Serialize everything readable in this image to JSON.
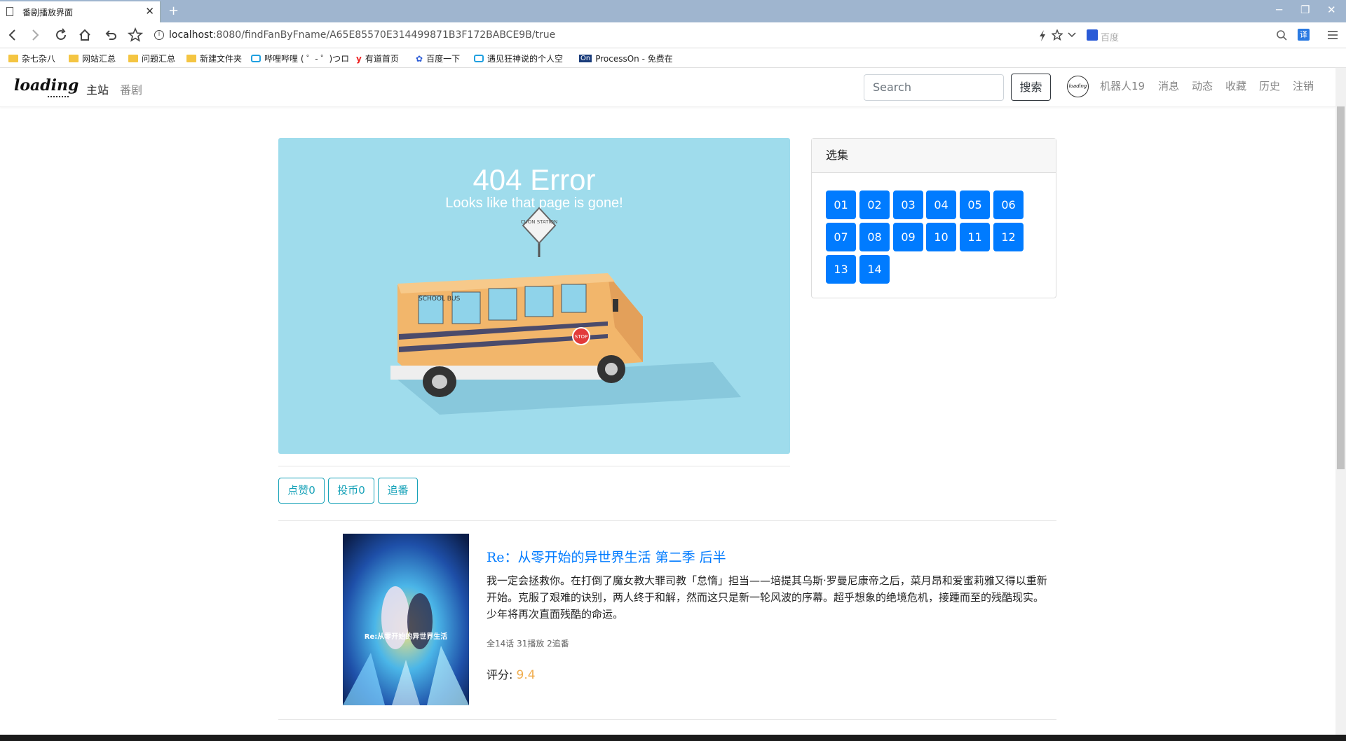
{
  "browser": {
    "tab_title": "番剧播放界面",
    "tab_close": "✕",
    "new_tab": "+",
    "url_host": "localhost",
    "url_rest": ":8080/findFanByFname/A65E85570E314499871B3F172BABCE9B/true",
    "search_engine_placeholder": "百度",
    "window_controls": [
      "─",
      "❐",
      "✕"
    ]
  },
  "bookmarks": [
    {
      "label": "杂七杂八",
      "icon": "folder-icon"
    },
    {
      "label": "网站汇总",
      "icon": "folder-icon"
    },
    {
      "label": "问题汇总",
      "icon": "folder-icon"
    },
    {
      "label": "新建文件夹",
      "icon": "folder-icon"
    },
    {
      "label": "哔哩哔哩 ( ゜- ゜)つロ",
      "icon": "bilibili-icon"
    },
    {
      "label": "有道首页",
      "icon": "youdao-icon"
    },
    {
      "label": "百度一下",
      "icon": "baidu-paw-icon"
    },
    {
      "label": "遇见狂神说的个人空",
      "icon": "bilibili-icon"
    },
    {
      "label": "ProcessOn - 免费在",
      "icon": "processon-icon"
    }
  ],
  "navbar": {
    "logo": "loading",
    "links": [
      "主站",
      "番剧"
    ],
    "search_placeholder": "Search",
    "search_button": "搜索",
    "avatar_text": "loading",
    "username": "机器人19",
    "right_links": [
      "消息",
      "动态",
      "收藏",
      "历史",
      "注销"
    ]
  },
  "player": {
    "error_title": "404 Error",
    "error_subtitle": "Looks like that page is gone!",
    "bus_sign": "SCHOOL BUS",
    "road_sign": "CUON STATION",
    "stop_sign": "STOP"
  },
  "actions": {
    "like": "点赞0",
    "coin": "投币0",
    "follow": "追番"
  },
  "episodes": {
    "header": "选集",
    "list": [
      "01",
      "02",
      "03",
      "04",
      "05",
      "06",
      "07",
      "08",
      "09",
      "10",
      "11",
      "12",
      "13",
      "14"
    ]
  },
  "anime": {
    "title": "Re：从零开始的异世界生活 第二季 后半",
    "description": "我一定会拯救你。在打倒了魔女教大罪司教「怠惰」担当——培提其乌斯·罗曼尼康帝之后，菜月昂和爱蜜莉雅又得以重新开始。克服了艰难的诀别，两人终于和解，然而这只是新一轮风波的序幕。超乎想象的绝境危机，接踵而至的残酷现实。少年将再次直面残酷的命运。",
    "stats": "全14话 31播放 2追番",
    "score_label": "评分:",
    "score_value": "9.4",
    "poster_text": "Re:从零开始的异世界生活"
  },
  "colors": {
    "primary": "#007bff",
    "info": "#17a2b8",
    "score": "#f0ad4e",
    "video_bg": "#9fdcec"
  }
}
